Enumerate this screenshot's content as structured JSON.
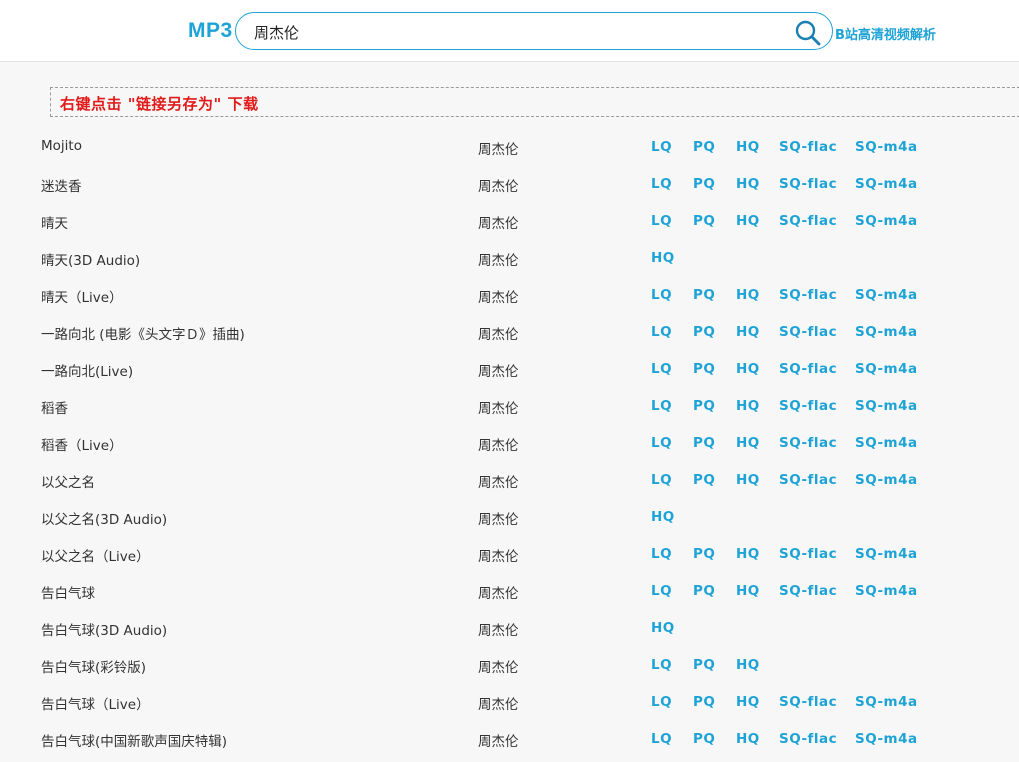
{
  "header": {
    "logo": "MP3",
    "search_value": "周杰伦",
    "search_icon": "search-icon",
    "bili_link": "B站高清视频解析"
  },
  "notice": "右键点击 \"链接另存为\" 下载",
  "quality_labels": {
    "lq": "LQ",
    "pq": "PQ",
    "hq": "HQ",
    "flac": "SQ-flac",
    "m4a": "SQ-m4a"
  },
  "songs": [
    {
      "title": "Mojito",
      "artist": "周杰伦"
    },
    {
      "title": "迷迭香",
      "artist": "周杰伦"
    },
    {
      "title": "晴天",
      "artist": "周杰伦"
    },
    {
      "title": "晴天(3D Audio)",
      "artist": "周杰伦"
    },
    {
      "title": "晴天（Live）",
      "artist": "周杰伦"
    },
    {
      "title": "一路向北 (电影《头文字Ｄ》插曲)",
      "artist": "周杰伦"
    },
    {
      "title": "一路向北(Live)",
      "artist": "周杰伦"
    },
    {
      "title": "稻香",
      "artist": "周杰伦"
    },
    {
      "title": "稻香（Live）",
      "artist": "周杰伦"
    },
    {
      "title": "以父之名",
      "artist": "周杰伦"
    },
    {
      "title": "以父之名(3D Audio)",
      "artist": "周杰伦"
    },
    {
      "title": "以父之名（Live）",
      "artist": "周杰伦"
    },
    {
      "title": "告白气球",
      "artist": "周杰伦"
    },
    {
      "title": "告白气球(3D Audio)",
      "artist": "周杰伦"
    },
    {
      "title": "告白气球(彩铃版)",
      "artist": "周杰伦"
    },
    {
      "title": "告白气球（Live）",
      "artist": "周杰伦"
    },
    {
      "title": "告白气球(中国新歌声国庆特辑)",
      "artist": "周杰伦"
    }
  ],
  "colors": {
    "accent": "#1ea3d6",
    "notice": "#e11a1a"
  }
}
